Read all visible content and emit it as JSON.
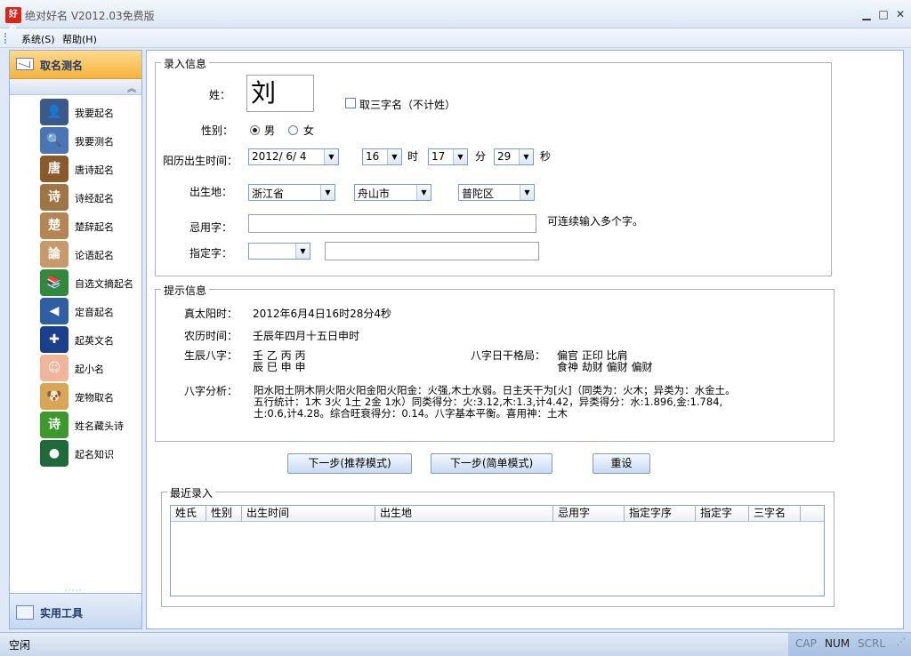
{
  "window": {
    "icon_text": "好名",
    "title": "绝对好名 V2012.03免费版",
    "min": "▁",
    "max": "□",
    "close": "✕"
  },
  "menu": {
    "items": [
      "系统(S)",
      "帮助(H)"
    ]
  },
  "sidebar": {
    "header": "取名测名",
    "collapse": "︽",
    "items": [
      {
        "label": "我要起名",
        "icon": "person-icon",
        "glyph": "👤",
        "color": "#3b5a8a"
      },
      {
        "label": "我要测名",
        "icon": "magnifier-icon",
        "glyph": "🔍",
        "color": "#4a74b8"
      },
      {
        "label": "唐诗起名",
        "icon": "tang-poetry-icon",
        "glyph": "唐",
        "color": "#8a5a2b"
      },
      {
        "label": "诗经起名",
        "icon": "book-of-songs-icon",
        "glyph": "诗",
        "color": "#a07444"
      },
      {
        "label": "楚辞起名",
        "icon": "chu-ci-icon",
        "glyph": "楚",
        "color": "#b58652"
      },
      {
        "label": "论语起名",
        "icon": "analects-icon",
        "glyph": "論",
        "color": "#c89a6a"
      },
      {
        "label": "自选文摘起名",
        "icon": "books-icon",
        "glyph": "📚",
        "color": "#2f8a3a"
      },
      {
        "label": "定音起名",
        "icon": "speaker-icon",
        "glyph": "◀",
        "color": "#2e5fa5"
      },
      {
        "label": "起英文名",
        "icon": "uk-flag-icon",
        "glyph": "✚",
        "color": "#1b3f8f"
      },
      {
        "label": "起小名",
        "icon": "baby-icon",
        "glyph": "☺",
        "color": "#f0b59a"
      },
      {
        "label": "宠物取名",
        "icon": "puppy-icon",
        "glyph": "🐶",
        "color": "#d9a654"
      },
      {
        "label": "姓名藏头诗",
        "icon": "poem-icon",
        "glyph": "诗",
        "color": "#3b9a2a"
      },
      {
        "label": "起名知识",
        "icon": "globe-icon",
        "glyph": "●",
        "color": "#1f6a3a"
      }
    ],
    "footer": "实用工具",
    "footer_dots": "·····"
  },
  "input_group": {
    "title": "录入信息",
    "surname_label": "姓：",
    "surname_value": "刘",
    "three_char_label": "取三字名（不计姓）",
    "gender_label": "性别：",
    "male": "男",
    "female": "女",
    "birth_label": "阳历出生时间：",
    "birth_date": "2012/ 6/ 4",
    "hour": "16",
    "hour_unit": "时",
    "minute": "17",
    "minute_unit": "分",
    "second": "29",
    "second_unit": "秒",
    "place_label": "出生地：",
    "province": "浙江省",
    "city": "舟山市",
    "district": "普陀区",
    "avoid_label": "忌用字：",
    "avoid_value": "",
    "avoid_hint": "可连续输入多个字。",
    "assign_label": "指定字：",
    "assign_select": "",
    "assign_value": ""
  },
  "hint_group": {
    "title": "提示信息",
    "solar_label": "真太阳时：",
    "solar_value": "2012年6月4日16时28分4秒",
    "lunar_label": "农历时间：",
    "lunar_value": "壬辰年四月十五日申时",
    "bazi_label": "生辰八字：",
    "bazi_line1": "壬  乙  丙  丙",
    "bazi_line2": "辰  巳  申  申",
    "geju_label": "八字日干格局：",
    "geju_line1": "偏官  正印        比肩",
    "geju_line2": "食神  劫财  偏财  偏财",
    "analysis_label": "八字分析：",
    "analysis_line1": "阳水阳土阴木阴火阳火阳金阳火阳金：火强,木土水弱。日主天干为[火]（同类为：火木；异类为：水金土。",
    "analysis_line2": "五行统计：1木 3火 1土 2金 1水）同类得分：火:3.12,木:1.3,计4.42，异类得分：水:1.896,金:1.784,",
    "analysis_line3": "土:0.6,计4.28。综合旺衰得分：0.14。八字基本平衡。喜用神：土木"
  },
  "buttons": {
    "next_recommend": "下一步(推荐模式)",
    "next_simple": "下一步(简单模式)",
    "reset": "重设"
  },
  "recent": {
    "title": "最近录入",
    "columns": [
      "姓氏",
      "性别",
      "出生时间",
      "出生地",
      "忌用字",
      "指定字序",
      "指定字",
      "三字名"
    ]
  },
  "status": {
    "text": "空闲",
    "cap": "CAP",
    "num": "NUM",
    "scrl": "SCRL"
  }
}
